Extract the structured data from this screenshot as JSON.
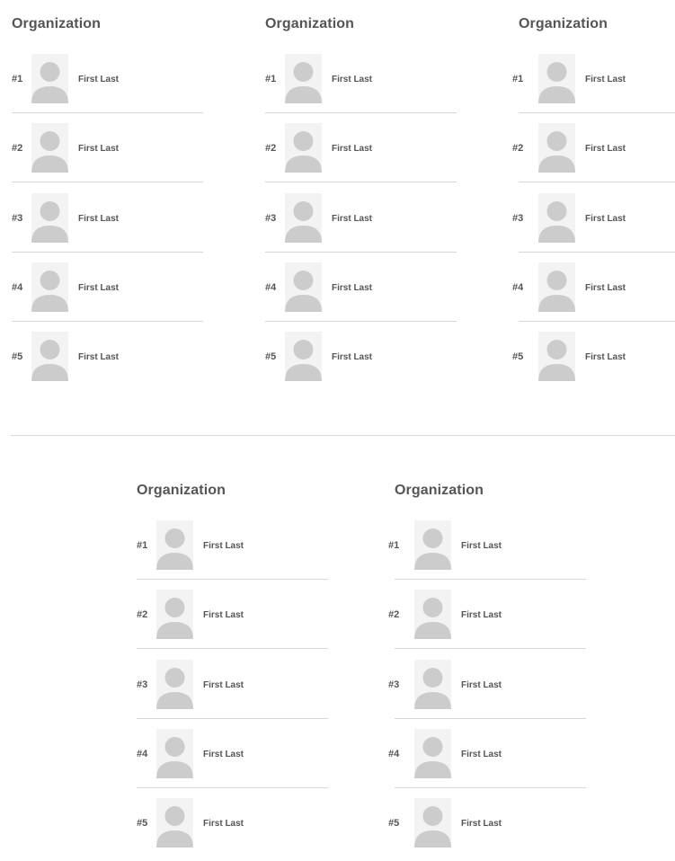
{
  "organizations": [
    {
      "title": "Organization",
      "members": [
        {
          "rank": "#1",
          "name": "First Last"
        },
        {
          "rank": "#2",
          "name": "First Last"
        },
        {
          "rank": "#3",
          "name": "First Last"
        },
        {
          "rank": "#4",
          "name": "First Last"
        },
        {
          "rank": "#5",
          "name": "First Last"
        }
      ]
    },
    {
      "title": "Organization",
      "members": [
        {
          "rank": "#1",
          "name": "First Last"
        },
        {
          "rank": "#2",
          "name": "First Last"
        },
        {
          "rank": "#3",
          "name": "First Last"
        },
        {
          "rank": "#4",
          "name": "First Last"
        },
        {
          "rank": "#5",
          "name": "First Last"
        }
      ]
    },
    {
      "title": "Organization",
      "members": [
        {
          "rank": "#1",
          "name": "First Last"
        },
        {
          "rank": "#2",
          "name": "First Last"
        },
        {
          "rank": "#3",
          "name": "First Last"
        },
        {
          "rank": "#4",
          "name": "First Last"
        },
        {
          "rank": "#5",
          "name": "First Last"
        }
      ]
    },
    {
      "title": "Organization",
      "members": [
        {
          "rank": "#1",
          "name": "First Last"
        },
        {
          "rank": "#2",
          "name": "First Last"
        },
        {
          "rank": "#3",
          "name": "First Last"
        },
        {
          "rank": "#4",
          "name": "First Last"
        },
        {
          "rank": "#5",
          "name": "First Last"
        }
      ]
    },
    {
      "title": "Organization",
      "members": [
        {
          "rank": "#1",
          "name": "First Last"
        },
        {
          "rank": "#2",
          "name": "First Last"
        },
        {
          "rank": "#3",
          "name": "First Last"
        },
        {
          "rank": "#4",
          "name": "First Last"
        },
        {
          "rank": "#5",
          "name": "First Last"
        }
      ]
    }
  ],
  "icons": {
    "avatar": "person-placeholder-icon"
  },
  "colors": {
    "text": "#555555",
    "avatar_bg": "#f3f3f3",
    "avatar_fg": "#cccccc",
    "divider": "#d6d6d6"
  }
}
